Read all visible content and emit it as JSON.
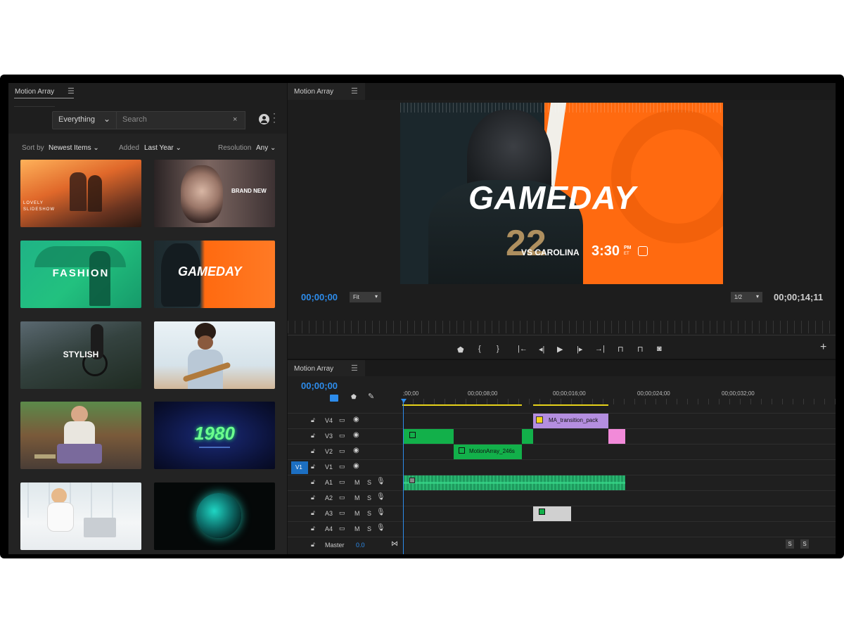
{
  "library": {
    "title": "Motion Array",
    "category": "Everything",
    "search_placeholder": "Search",
    "sort_label": "Sort by",
    "sort_value": "Newest Items",
    "added_label": "Added",
    "added_value": "Last Year",
    "resolution_label": "Resolution",
    "resolution_value": "Any",
    "thumbnails": [
      {
        "caption": "LOVELY SLIDESHOW"
      },
      {
        "caption": "BRAND NEW"
      },
      {
        "caption": "FASHION"
      },
      {
        "caption": "GAMEDAY"
      },
      {
        "caption": "STYLISH"
      },
      {
        "caption": ""
      },
      {
        "caption": ""
      },
      {
        "caption": "1980"
      },
      {
        "caption": ""
      },
      {
        "caption": ""
      }
    ]
  },
  "monitor": {
    "title": "Motion Array",
    "video_title": "GAMEDAY",
    "video_sub": "VS CAROLINA",
    "video_time": "3:30",
    "video_time_suffix": "PM",
    "video_time_tz": "ET",
    "timecode_in": "00;00;00",
    "zoom": "Fit",
    "resolution": "1/2",
    "timecode_out": "00;00;14;11"
  },
  "timeline": {
    "title": "Motion Array",
    "timecode": "00;00;00",
    "ruler": [
      ";00;00",
      "00;00;08;00",
      "00;00;016;00",
      "00;00;024;00",
      "00;00;032;00"
    ],
    "tracks": [
      {
        "name": "V4"
      },
      {
        "name": "V3"
      },
      {
        "name": "V2"
      },
      {
        "name": "V1",
        "target": "V1"
      },
      {
        "name": "A1"
      },
      {
        "name": "A2"
      },
      {
        "name": "A3"
      },
      {
        "name": "A4"
      }
    ],
    "master_label": "Master",
    "master_value": "0.0",
    "clip_transition": "MA_transition_pack",
    "clip_motion": "MotionArray_246s",
    "solo_btn": "S",
    "mute_btn": "M",
    "add_btn": "+"
  },
  "colors": {
    "accent_blue": "#2d8ceb",
    "clip_green": "#12b04a",
    "clip_purple": "#b48ee0",
    "clip_pink": "#f28ad9",
    "audio_teal": "#1e9a5e",
    "gameday_orange": "#ff6a10"
  }
}
